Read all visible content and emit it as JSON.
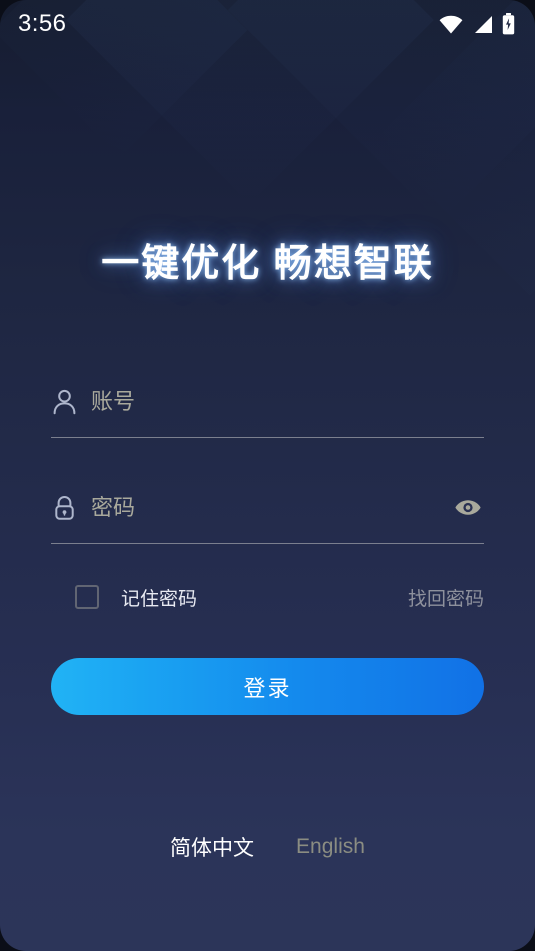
{
  "statusbar": {
    "time": "3:56",
    "icons": [
      {
        "name": "wifi-icon",
        "label": "wifi"
      },
      {
        "name": "cellular-signal-icon",
        "label": "cellular"
      },
      {
        "name": "battery-charging-icon",
        "label": "battery-charging"
      }
    ]
  },
  "brand": {
    "slogan": "一键优化  畅想智联"
  },
  "form": {
    "account": {
      "icon": "user-icon",
      "value": "",
      "placeholder": "账号"
    },
    "password": {
      "icon": "lock-icon",
      "value": "",
      "placeholder": "密码",
      "visibility_icon": "eye-icon"
    },
    "remember_label": "记住密码",
    "remember_checked": false,
    "forgot_label": "找回密码",
    "login_label": "登录"
  },
  "language": {
    "options": [
      {
        "label": "简体中文",
        "active": true
      },
      {
        "label": "English",
        "active": false
      }
    ]
  },
  "colors": {
    "bg_top": "#161d30",
    "bg_bottom": "#2c3559",
    "button_start": "#21b3f5",
    "button_end": "#1171e6",
    "placeholder": "#a9a99c",
    "muted": "#8e919d",
    "divider": "#7b7f8e"
  }
}
